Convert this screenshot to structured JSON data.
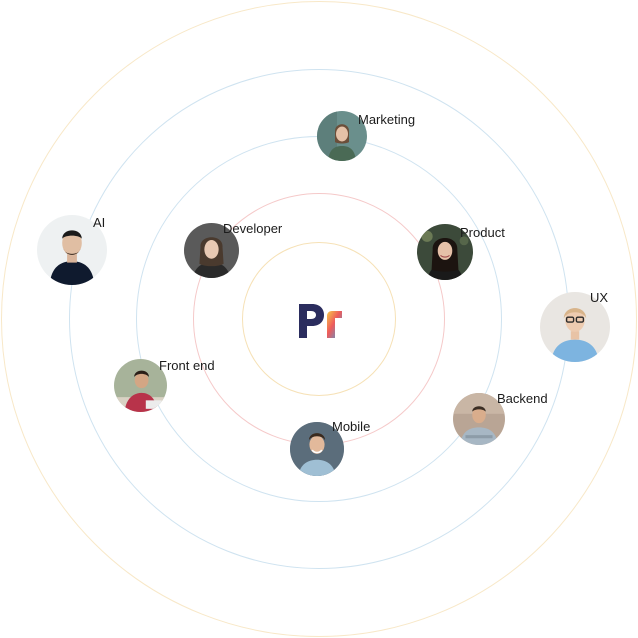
{
  "center_logo": {
    "text": "Pr",
    "colors": {
      "P": "#2b2d5e",
      "r_gradient": [
        "#f7c948",
        "#ee5b5b",
        "#3aa3e3"
      ]
    }
  },
  "rings": {
    "colors": [
      "#f6e1b6",
      "#f5c9c9",
      "#cfe3f0",
      "#cfe3f0",
      "#f8e8c8"
    ]
  },
  "people": [
    {
      "id": "marketing",
      "label": "Marketing",
      "avatar_bg": "#6a8f8c",
      "shirt": "#4a6a55",
      "hair": "#6b4f3a"
    },
    {
      "id": "ai",
      "label": "AI",
      "avatar_bg": "#eef1f2",
      "shirt": "#0f1a2e",
      "hair": "#1b1b1b"
    },
    {
      "id": "developer",
      "label": "Developer",
      "avatar_bg": "#5a5a5a",
      "shirt": "#2a2a2a",
      "hair": "#4a3a2e"
    },
    {
      "id": "product",
      "label": "Product",
      "avatar_bg": "#3c4a3a",
      "shirt": "#1a1a1a",
      "hair": "#1c1410"
    },
    {
      "id": "ux",
      "label": "UX",
      "avatar_bg": "#e9e6e2",
      "shirt": "#7db4e0",
      "hair": "#d8b48a"
    },
    {
      "id": "frontend",
      "label": "Front end",
      "avatar_bg": "#a7b39a",
      "shirt": "#b8334a",
      "hair": "#2a1f18"
    },
    {
      "id": "backend",
      "label": "Backend",
      "avatar_bg": "#b9a595",
      "shirt": "#a7b7c4",
      "hair": "#3b2e24"
    },
    {
      "id": "mobile",
      "label": "Mobile",
      "avatar_bg": "#4a5c6a",
      "shirt": "#9fbfd4",
      "hair": "#3a2a1e"
    }
  ]
}
